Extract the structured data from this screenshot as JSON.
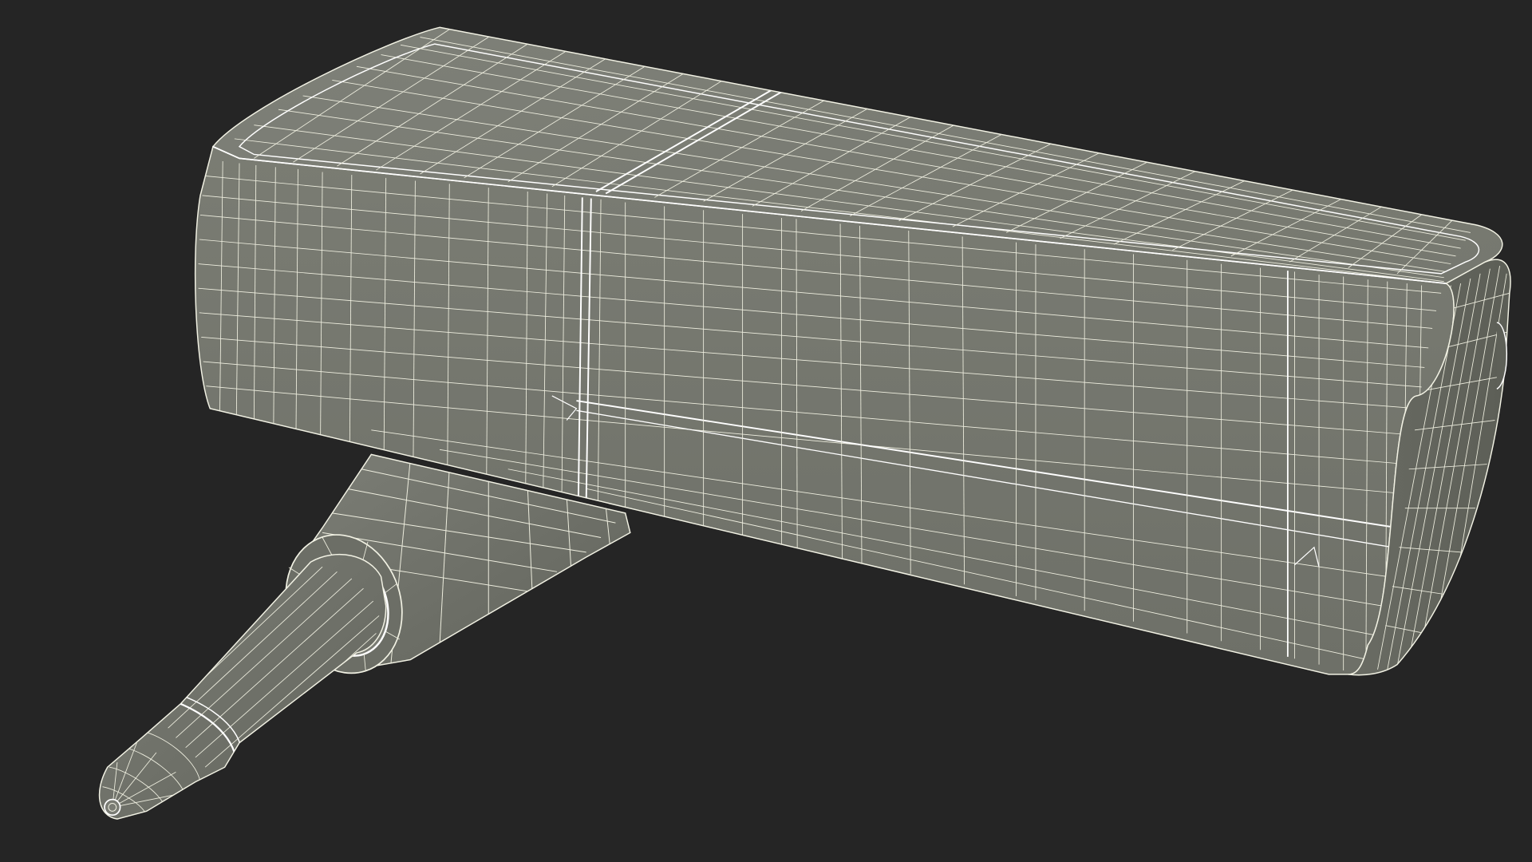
{
  "scene": {
    "subject": "wireframe-render-adapter-with-plug",
    "colors": {
      "background": "#252525",
      "surface_light": "#80827a",
      "surface_mid": "#74766e",
      "surface_dark": "#64665e",
      "surface_shadow": "#55574f",
      "wire": "#f2f2e4",
      "wire_bright": "#ffffff"
    }
  }
}
